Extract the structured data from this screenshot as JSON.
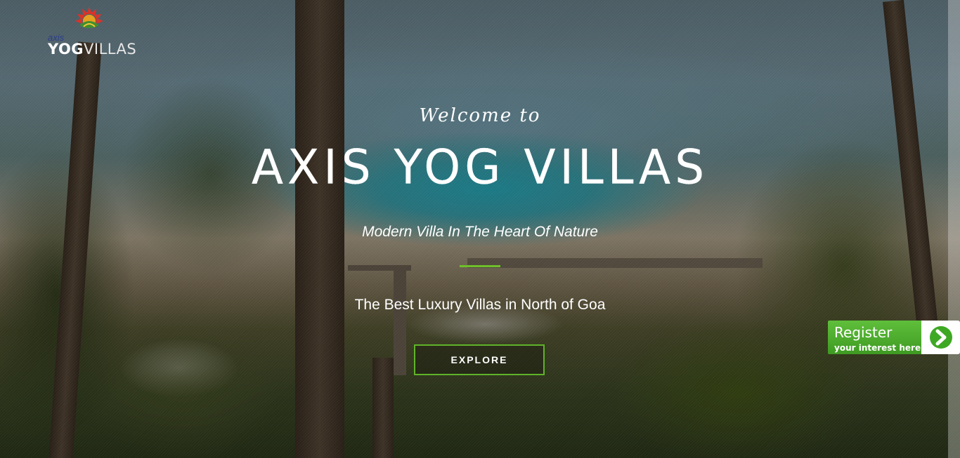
{
  "brand": {
    "small": "axis",
    "main_part1": "YOG",
    "main_part2": "VILLAS"
  },
  "hero": {
    "welcome": "Welcome to",
    "title": "AXIS YOG VILLAS",
    "subtitle": "Modern Villa In The Heart Of Nature",
    "tagline": "The Best Luxury Villas in North of Goa",
    "cta_label": "EXPLORE",
    "accent_color": "#6fbf2a"
  },
  "register": {
    "title": "Register",
    "subtitle": "your interest here",
    "icon": "chevron-right-icon",
    "color": "#4caf2a"
  }
}
